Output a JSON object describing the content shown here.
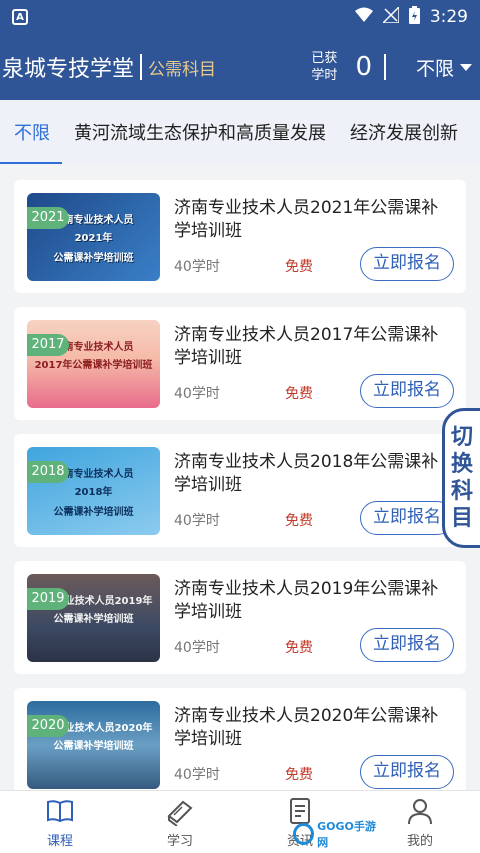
{
  "status_bar": {
    "time": "3:29"
  },
  "header": {
    "brand": "泉城专技学堂",
    "subtitle": "公需科目",
    "earned_label_line1": "已获",
    "earned_label_line2": "学时",
    "earned_count": "0",
    "filter": "不限"
  },
  "tabs": [
    {
      "label": "不限",
      "active": true
    },
    {
      "label": "黄河流域生态保护和高质量发展",
      "active": false
    },
    {
      "label": "经济发展创新",
      "active": false
    }
  ],
  "courses": [
    {
      "year": "2021",
      "title": "济南专业技术人员2021年公需课补学培训班",
      "hours": "40学时",
      "price": "免费",
      "button": "立即报名",
      "thumb_lines": [
        "济南专业技术人员",
        "2021年",
        "公需课补学培训班"
      ]
    },
    {
      "year": "2017",
      "title": "济南专业技术人员2017年公需课补学培训班",
      "hours": "40学时",
      "price": "免费",
      "button": "立即报名",
      "thumb_lines": [
        "济南专业技术人员",
        "2017年公需课补学培训班",
        ""
      ]
    },
    {
      "year": "2018",
      "title": "济南专业技术人员2018年公需课补学培训班",
      "hours": "40学时",
      "price": "免费",
      "button": "立即报名",
      "thumb_lines": [
        "济南专业技术人员",
        "2018年",
        "公需课补学培训班"
      ]
    },
    {
      "year": "2019",
      "title": "济南专业技术人员2019年公需课补学培训班",
      "hours": "40学时",
      "price": "免费",
      "button": "立即报名",
      "thumb_lines": [
        "济南专业技术人员2019年",
        "公需课补学培训班",
        ""
      ]
    },
    {
      "year": "2020",
      "title": "济南专业技术人员2020年公需课补学培训班",
      "hours": "40学时",
      "price": "免费",
      "button": "立即报名",
      "thumb_lines": [
        "济南专业技术人员2020年",
        "公需课补学培训班",
        ""
      ]
    }
  ],
  "side_switch": [
    "切",
    "换",
    "科",
    "目"
  ],
  "bottom_nav": [
    {
      "label": "课程",
      "icon": "book-icon",
      "active": true
    },
    {
      "label": "学习",
      "icon": "books-stack-icon",
      "active": false
    },
    {
      "label": "资讯",
      "icon": "document-icon",
      "active": false
    },
    {
      "label": "我的",
      "icon": "user-icon",
      "active": false
    }
  ],
  "watermark": "GOGO手游网",
  "colors": {
    "primary": "#2f5597",
    "accent_blue": "#2f6fd6",
    "price_red": "#c23a2a",
    "badge_green": "#5fb37a"
  }
}
